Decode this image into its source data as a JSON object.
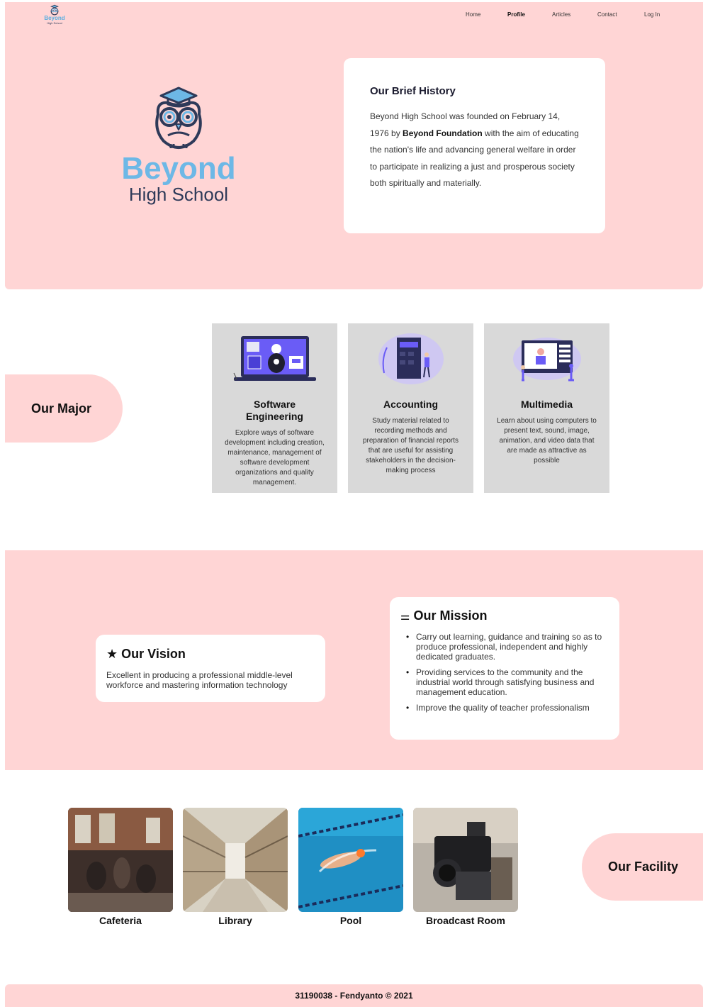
{
  "brand": {
    "line1": "Beyond",
    "line2": "High School"
  },
  "nav": {
    "items": [
      "Home",
      "Profile",
      "Articles",
      "Contact",
      "Log In"
    ],
    "active": "Profile"
  },
  "history": {
    "title": "Our Brief History",
    "text_before": "Beyond High School was founded on February 14, 1976 by ",
    "text_bold": "Beyond Foundation",
    "text_after": " with the aim of educating the nation's life and advancing general welfare in order to participate in realizing a just and prosperous society both spiritually and materially."
  },
  "major": {
    "title": "Our Major",
    "cards": [
      {
        "name": "Software Engineering",
        "desc": "Explore ways of software development including creation, maintenance, management of software development organizations and quality management."
      },
      {
        "name": "Accounting",
        "desc": "Study material related to recording methods and preparation of financial reports that are useful for assisting stakeholders in the decision-making process"
      },
      {
        "name": "Multimedia",
        "desc": "Learn about using computers to present text, sound, image, animation, and video data that are made as attractive as possible"
      }
    ]
  },
  "vision": {
    "title": "Our Vision",
    "icon": "star-icon",
    "text": "Excellent in producing a professional middle-level workforce and mastering information technology"
  },
  "mission": {
    "title": "Our Mission",
    "icon": "list-icon",
    "items": [
      "Carry out learning, guidance and training so as to produce professional, independent and highly dedicated graduates.",
      "Providing services to the community and the industrial world through satisfying business and management education.",
      "Improve the quality of teacher professionalism"
    ]
  },
  "facility": {
    "title": "Our Facility",
    "items": [
      "Cafeteria",
      "Library",
      "Pool",
      "Broadcast Room"
    ]
  },
  "footer": {
    "text": "31190038 - Fendyanto © 2021"
  },
  "colors": {
    "pink": "#ffd5d5",
    "brand_blue": "#6db8e6",
    "navy": "#2e3a59",
    "card_gray": "#d9d9d9"
  }
}
